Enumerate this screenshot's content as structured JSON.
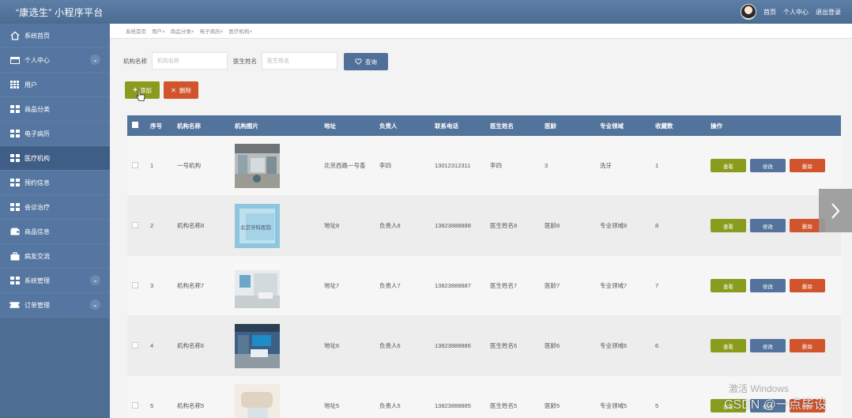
{
  "header": {
    "title": "“康选生” 小程序平台",
    "links": [
      "首页",
      "个人中心",
      "退出登录"
    ]
  },
  "sidebar": {
    "items": [
      {
        "label": "系统首页",
        "icon": "home-icon",
        "expandable": false
      },
      {
        "label": "个人中心",
        "icon": "id-card-icon",
        "expandable": true
      },
      {
        "label": "用户",
        "icon": "grid-icon",
        "expandable": false
      },
      {
        "label": "商品分类",
        "icon": "grid-icon",
        "expandable": false
      },
      {
        "label": "电子病历",
        "icon": "grid-icon",
        "expandable": false
      },
      {
        "label": "医疗机构",
        "icon": "grid-icon",
        "expandable": false,
        "active": true
      },
      {
        "label": "预约信息",
        "icon": "grid-icon",
        "expandable": false
      },
      {
        "label": "会诊治疗",
        "icon": "grid-icon",
        "expandable": false
      },
      {
        "label": "商品信息",
        "icon": "wallet-icon",
        "expandable": false
      },
      {
        "label": "病友交流",
        "icon": "briefcase-icon",
        "expandable": false
      },
      {
        "label": "系统管理",
        "icon": "grid-icon",
        "expandable": true
      },
      {
        "label": "订单管理",
        "icon": "ticket-icon",
        "expandable": true
      }
    ]
  },
  "tabs": [
    "系统首页",
    "用户×",
    "商品分类×",
    "电子病历×",
    "医疗机构×"
  ],
  "search": {
    "org_label": "机构名称",
    "org_placeholder": "机构名称",
    "doctor_label": "医生姓名",
    "doctor_placeholder": "医生姓名",
    "button": "查询"
  },
  "actions": {
    "add": "添加",
    "delete": "删除"
  },
  "table": {
    "columns": [
      "序号",
      "机构名称",
      "机构图片",
      "地址",
      "负责人",
      "联系电话",
      "医生姓名",
      "医龄",
      "专业领域",
      "收藏数",
      "操作"
    ],
    "rows": [
      {
        "no": "1",
        "name": "一号机构",
        "address": "北京西路一号香",
        "leader": "李四",
        "phone": "13012312311",
        "doctor": "李四",
        "age": "3",
        "field": "洗牙",
        "fav": "1",
        "image_caption": ""
      },
      {
        "no": "2",
        "name": "机构名称8",
        "address": "地址8",
        "leader": "负责人8",
        "phone": "13823888888",
        "doctor": "医生姓名8",
        "age": "医龄8",
        "field": "专业领域8",
        "fav": "8",
        "image_caption": "北京牙科医院"
      },
      {
        "no": "3",
        "name": "机构名称7",
        "address": "地址7",
        "leader": "负责人7",
        "phone": "13823888887",
        "doctor": "医生姓名7",
        "age": "医龄7",
        "field": "专业领域7",
        "fav": "7",
        "image_caption": ""
      },
      {
        "no": "4",
        "name": "机构名称6",
        "address": "地址6",
        "leader": "负责人6",
        "phone": "13823888886",
        "doctor": "医生姓名6",
        "age": "医龄6",
        "field": "专业领域6",
        "fav": "6",
        "image_caption": ""
      },
      {
        "no": "5",
        "name": "机构名称5",
        "address": "地址5",
        "leader": "负责人5",
        "phone": "13823888885",
        "doctor": "医生姓名5",
        "age": "医龄5",
        "field": "专业领域5",
        "fav": "5",
        "image_caption": ""
      }
    ],
    "row_actions": {
      "view": "查看",
      "edit": "修改",
      "delete": "删除"
    }
  },
  "watermark": {
    "windows": "激活 Windows",
    "csdn": "CSDN @一点毕设"
  },
  "colors": {
    "primary": "#52739b",
    "sidebar": "#4d6d93",
    "success": "#8a9c1e",
    "danger": "#d1542d"
  }
}
